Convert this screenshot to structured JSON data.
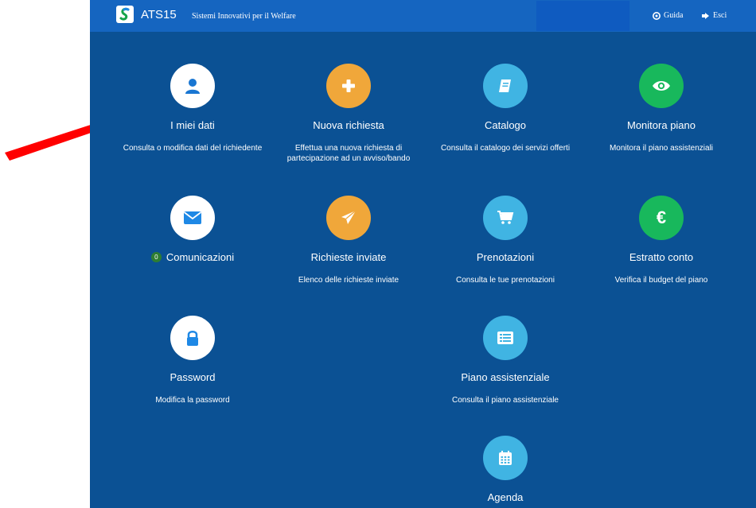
{
  "header": {
    "brand": "ATS15",
    "tagline": "Sistemi Innovativi per il Welfare",
    "help_label": "Guida",
    "logout_label": "Esci"
  },
  "tiles": [
    {
      "title": "I miei dati",
      "desc": "Consulta o modifica dati del richiedente",
      "icon": "user-icon",
      "color": "#ffffff"
    },
    {
      "title": "Nuova richiesta",
      "desc": "Effettua una nuova richiesta di partecipazione ad un avviso/bando",
      "icon": "plus-icon",
      "color": "#f0a73a"
    },
    {
      "title": "Catalogo",
      "desc": "Consulta il catalogo dei servizi offerti",
      "icon": "book-icon",
      "color": "#40b4e3"
    },
    {
      "title": "Monitora piano",
      "desc": "Monitora il piano assistenziali",
      "icon": "eye-icon",
      "color": "#18b85c"
    },
    {
      "title": "Comunicazioni",
      "badge": "0",
      "desc": "",
      "icon": "envelope-icon",
      "color": "#ffffff"
    },
    {
      "title": "Richieste inviate",
      "desc": "Elenco delle richieste inviate",
      "icon": "paper-plane-icon",
      "color": "#f0a73a"
    },
    {
      "title": "Prenotazioni",
      "desc": "Consulta le tue prenotazioni",
      "icon": "cart-icon",
      "color": "#40b4e3"
    },
    {
      "title": "Estratto conto",
      "desc": "Verifica il budget del piano",
      "icon": "euro-icon",
      "color": "#18b85c"
    },
    {
      "title": "Password",
      "desc": "Modifica la password",
      "icon": "lock-icon",
      "color": "#ffffff"
    },
    {
      "title": "Piano assistenziale",
      "desc": "Consulta il piano assistenziale",
      "icon": "list-icon",
      "color": "#40b4e3"
    },
    {
      "title": "Agenda",
      "desc": "",
      "icon": "calendar-icon",
      "color": "#40b4e3"
    }
  ],
  "annotation": {
    "arrow_color": "#ff0000"
  }
}
